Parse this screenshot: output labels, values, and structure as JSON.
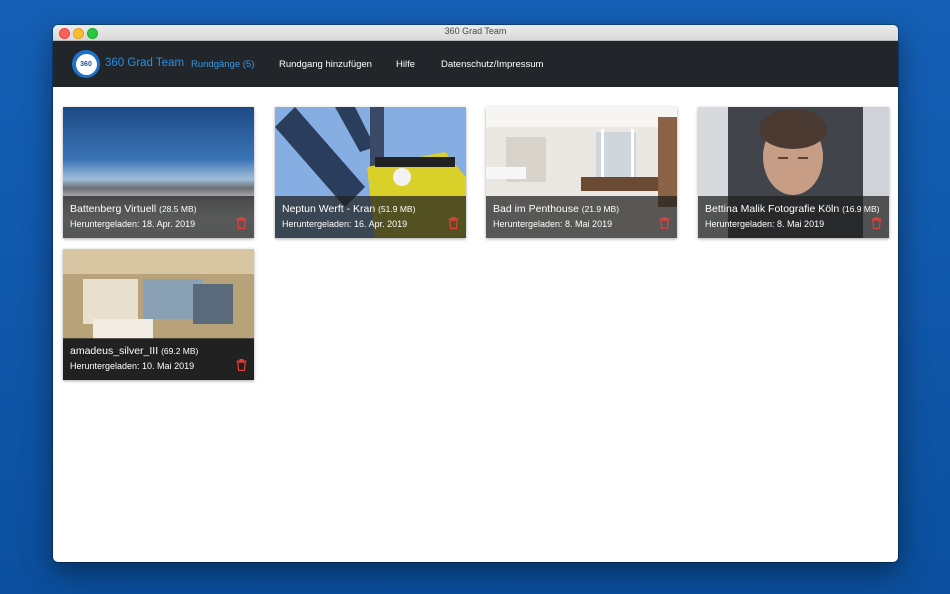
{
  "window": {
    "title": "360 Grad Team"
  },
  "nav": {
    "logo_text": "360",
    "brand": "360 Grad Team",
    "items": [
      {
        "label": "Rundgänge (5)",
        "active": true
      },
      {
        "label": "Rundgang hinzufügen",
        "active": false
      },
      {
        "label": "Hilfe",
        "active": false
      },
      {
        "label": "Datenschutz/Impressum",
        "active": false
      }
    ]
  },
  "tours": [
    {
      "title": "Battenberg Virtuell",
      "size": "(28.5 MB)",
      "date": "Heruntergeladen: 18. Apr. 2019",
      "thumb": "panorama-landscape"
    },
    {
      "title": "Neptun Werft - Kran",
      "size": "(51.9 MB)",
      "date": "Heruntergeladen: 16. Apr. 2019",
      "thumb": "crane"
    },
    {
      "title": "Bad im Penthouse",
      "size": "(21.9 MB)",
      "date": "Heruntergeladen: 8. Mai 2019",
      "thumb": "bathroom"
    },
    {
      "title": "Bettina Malik Fotografie Köln",
      "size": "(16.9 MB)",
      "date": "Heruntergeladen: 8. Mai 2019",
      "thumb": "portrait"
    },
    {
      "title": "amadeus_silver_III",
      "size": "(69.2 MB)",
      "date": "Heruntergeladen: 10. Mai 2019",
      "thumb": "lobby"
    }
  ],
  "colors": {
    "accent": "#3a9be6",
    "navbar": "#222529",
    "delete": "#e0403a",
    "background": "#0f57a8"
  }
}
